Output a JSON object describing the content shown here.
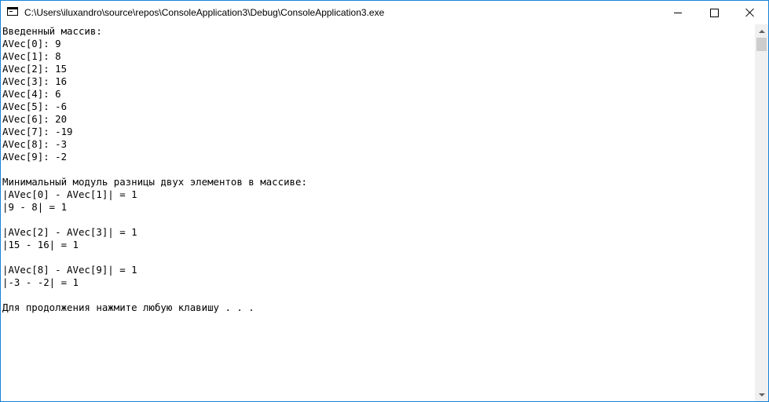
{
  "window": {
    "title": "C:\\Users\\iluxandro\\source\\repos\\ConsoleApplication3\\Debug\\ConsoleApplication3.exe",
    "border_color": "#1883d7",
    "controls": {
      "minimize_icon": "minimize-icon",
      "maximize_icon": "maximize-icon",
      "close_icon": "close-icon"
    }
  },
  "console": {
    "background": "#ffffff",
    "text_color": "#000000",
    "lines": [
      "Введенный массив:",
      "AVec[0]: 9",
      "AVec[1]: 8",
      "AVec[2]: 15",
      "AVec[3]: 16",
      "AVec[4]: 6",
      "AVec[5]: -6",
      "AVec[6]: 20",
      "AVec[7]: -19",
      "AVec[8]: -3",
      "AVec[9]: -2",
      "",
      "Минимальный модуль разницы двух элементов в массиве:",
      "|AVec[0] - AVec[1]| = 1",
      "|9 - 8| = 1",
      "",
      "|AVec[2] - AVec[3]| = 1",
      "|15 - 16| = 1",
      "",
      "|AVec[8] - AVec[9]| = 1",
      "|-3 - -2| = 1",
      "",
      "Для продолжения нажмите любую клавишу . . ."
    ]
  },
  "scrollbar": {
    "up_icon": "scroll-up-arrow-icon",
    "down_icon": "scroll-down-arrow-icon"
  }
}
